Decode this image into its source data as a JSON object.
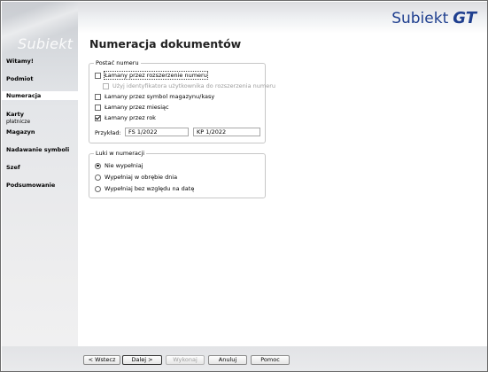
{
  "brand": {
    "name": "Subiekt",
    "suffix": "GT"
  },
  "sidebar": {
    "watermark": "Subiekt",
    "items": [
      {
        "label": "Witamy!"
      },
      {
        "label": "Podmiot"
      },
      {
        "label": "Numeracja",
        "active": true
      },
      {
        "label": "Karty",
        "sub": "płatnicze"
      },
      {
        "label": "Magazyn"
      },
      {
        "label": "Nadawanie symboli"
      },
      {
        "label": "Szef"
      },
      {
        "label": "Podsumowanie"
      }
    ]
  },
  "main": {
    "title": "Numeracja dokumentów",
    "postac": {
      "legend": "Postać numeru",
      "options": [
        {
          "label": "Łamany przez rozszerzenie numeru",
          "checked": false,
          "focused": true
        },
        {
          "label": "Użyj identyfikatora użytkownika do rozszerzenia numeru",
          "checked": false,
          "disabled": true
        },
        {
          "label": "Łamany przez symbol magazynu/kasy",
          "checked": false
        },
        {
          "label": "Łamany przez miesiąc",
          "checked": false
        },
        {
          "label": "Łamany przez rok",
          "checked": true
        }
      ],
      "example_label": "Przykład:",
      "example_values": [
        "FS 1/2022",
        "KP 1/2022"
      ]
    },
    "luki": {
      "legend": "Luki w numeracji",
      "options": [
        {
          "label": "Nie wypełniaj",
          "selected": true
        },
        {
          "label": "Wypełniaj w obrębie dnia",
          "selected": false
        },
        {
          "label": "Wypełniaj bez względu na datę",
          "selected": false
        }
      ]
    }
  },
  "footer": {
    "back": "< Wstecz",
    "next": "Dalej >",
    "finish": "Wykonaj",
    "cancel": "Anuluj",
    "help": "Pomoc"
  }
}
